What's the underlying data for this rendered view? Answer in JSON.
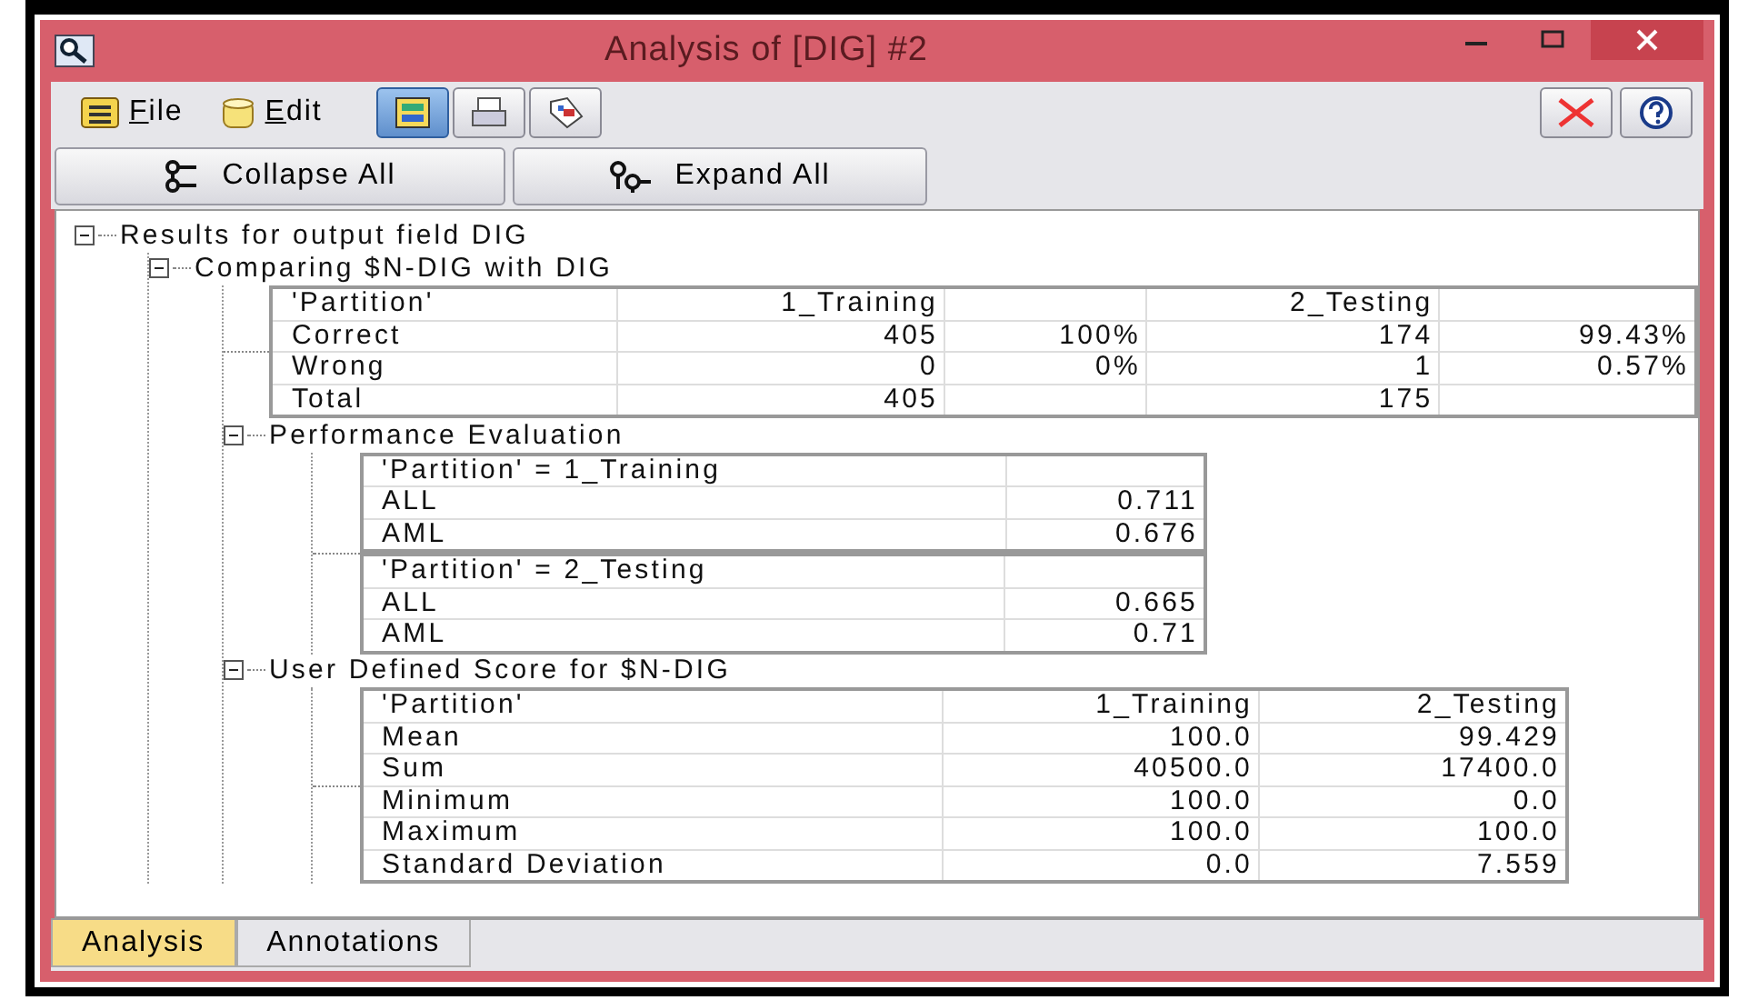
{
  "window": {
    "title": "Analysis of [DIG] #2"
  },
  "menu": [
    {
      "label": "File",
      "kind": "file"
    },
    {
      "label": "Edit",
      "kind": "edit"
    }
  ],
  "toolbar": [
    {
      "kind": "view",
      "selected": true
    },
    {
      "kind": "print",
      "selected": false
    },
    {
      "kind": "tag",
      "selected": false
    }
  ],
  "actions": [
    {
      "label": "Collapse All",
      "kind": "collapse"
    },
    {
      "label": "Expand All",
      "kind": "expand"
    }
  ],
  "tree": {
    "label": "Results for output field DIG",
    "expanded": true,
    "children": [
      {
        "label": "Comparing $N-DIG with DIG",
        "expanded": true,
        "tables": [
          {
            "rows": [
              [
                "'Partition'",
                "1_Training",
                null,
                "2_Testing",
                null
              ],
              [
                "Correct",
                "405",
                "100%",
                "174",
                "99.43%"
              ],
              [
                "Wrong",
                "0",
                "0%",
                "1",
                "0.57%"
              ],
              [
                "Total",
                "405",
                null,
                "175",
                null
              ]
            ]
          }
        ],
        "children": [
          {
            "label": "Performance Evaluation",
            "expanded": true,
            "tables": [
              {
                "rows": [
                  [
                    "'Partition' = 1_Training",
                    null
                  ],
                  [
                    "ALL",
                    "0.711"
                  ],
                  [
                    "AML",
                    "0.676"
                  ]
                ]
              },
              {
                "rows": [
                  [
                    "'Partition' = 2_Testing",
                    null
                  ],
                  [
                    "ALL",
                    "0.665"
                  ],
                  [
                    "AML",
                    "0.71"
                  ]
                ]
              }
            ]
          },
          {
            "label": "User Defined Score for $N-DIG",
            "expanded": true,
            "tables": [
              {
                "rows": [
                  [
                    "'Partition'",
                    "1_Training",
                    "2_Testing"
                  ],
                  [
                    "Mean",
                    "100.0",
                    "99.429"
                  ],
                  [
                    "Sum",
                    "40500.0",
                    "17400.0"
                  ],
                  [
                    "Minimum",
                    "100.0",
                    "0.0"
                  ],
                  [
                    "Maximum",
                    "100.0",
                    "100.0"
                  ],
                  [
                    "Standard Deviation",
                    "0.0",
                    "7.559"
                  ]
                ]
              }
            ]
          }
        ]
      }
    ]
  },
  "tabs": [
    {
      "label": "Analysis",
      "selected": true
    },
    {
      "label": "Annotations",
      "selected": false
    }
  ]
}
